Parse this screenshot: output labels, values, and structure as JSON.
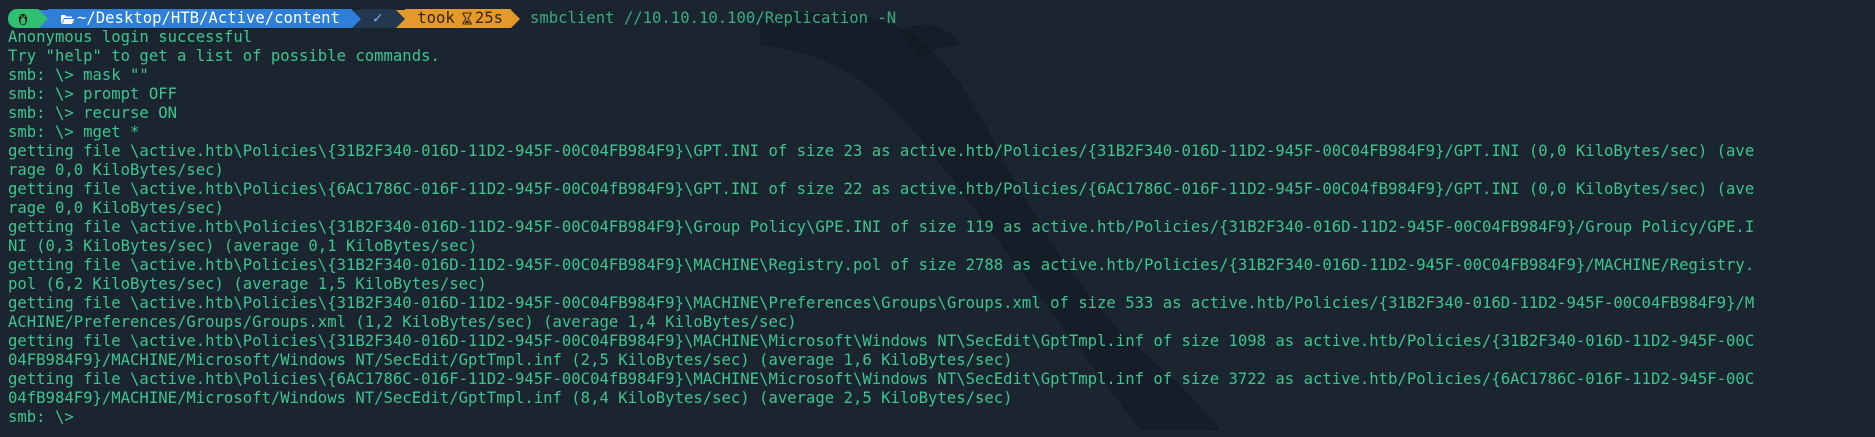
{
  "prompt": {
    "cwd": "~/Desktop/HTB/Active/content",
    "status": "✓",
    "took_label": "took",
    "took_time": "25s",
    "command": "smbclient //10.10.10.100/Replication -N"
  },
  "output": [
    "Anonymous login successful",
    "Try \"help\" to get a list of possible commands.",
    "smb: \\> mask \"\"",
    "smb: \\> prompt OFF",
    "smb: \\> recurse ON",
    "smb: \\> mget *",
    "getting file \\active.htb\\Policies\\{31B2F340-016D-11D2-945F-00C04FB984F9}\\GPT.INI of size 23 as active.htb/Policies/{31B2F340-016D-11D2-945F-00C04FB984F9}/GPT.INI (0,0 KiloBytes/sec) (ave",
    "rage 0,0 KiloBytes/sec)",
    "getting file \\active.htb\\Policies\\{6AC1786C-016F-11D2-945F-00C04fB984F9}\\GPT.INI of size 22 as active.htb/Policies/{6AC1786C-016F-11D2-945F-00C04fB984F9}/GPT.INI (0,0 KiloBytes/sec) (ave",
    "rage 0,0 KiloBytes/sec)",
    "getting file \\active.htb\\Policies\\{31B2F340-016D-11D2-945F-00C04FB984F9}\\Group Policy\\GPE.INI of size 119 as active.htb/Policies/{31B2F340-016D-11D2-945F-00C04FB984F9}/Group Policy/GPE.I",
    "NI (0,3 KiloBytes/sec) (average 0,1 KiloBytes/sec)",
    "getting file \\active.htb\\Policies\\{31B2F340-016D-11D2-945F-00C04FB984F9}\\MACHINE\\Registry.pol of size 2788 as active.htb/Policies/{31B2F340-016D-11D2-945F-00C04FB984F9}/MACHINE/Registry.",
    "pol (6,2 KiloBytes/sec) (average 1,5 KiloBytes/sec)",
    "getting file \\active.htb\\Policies\\{31B2F340-016D-11D2-945F-00C04FB984F9}\\MACHINE\\Preferences\\Groups\\Groups.xml of size 533 as active.htb/Policies/{31B2F340-016D-11D2-945F-00C04FB984F9}/M",
    "ACHINE/Preferences/Groups/Groups.xml (1,2 KiloBytes/sec) (average 1,4 KiloBytes/sec)",
    "getting file \\active.htb\\Policies\\{31B2F340-016D-11D2-945F-00C04FB984F9}\\MACHINE\\Microsoft\\Windows NT\\SecEdit\\GptTmpl.inf of size 1098 as active.htb/Policies/{31B2F340-016D-11D2-945F-00C",
    "04FB984F9}/MACHINE/Microsoft/Windows NT/SecEdit/GptTmpl.inf (2,5 KiloBytes/sec) (average 1,6 KiloBytes/sec)",
    "getting file \\active.htb\\Policies\\{6AC1786C-016F-11D2-945F-00C04fB984F9}\\MACHINE\\Microsoft\\Windows NT\\SecEdit\\GptTmpl.inf of size 3722 as active.htb/Policies/{6AC1786C-016F-11D2-945F-00C",
    "04fB984F9}/MACHINE/Microsoft/Windows NT/SecEdit/GptTmpl.inf (8,4 KiloBytes/sec) (average 2,5 KiloBytes/sec)",
    "smb: \\> "
  ],
  "colors": {
    "background": "#1b2530",
    "text": "#3ec48f",
    "os_segment": "#2fbf71",
    "dir_segment": "#2d7fd9",
    "status_segment": "#23384f",
    "time_segment": "#e39a2a"
  },
  "icons": {
    "os": "linux-penguin-icon",
    "dir": "folder-open-icon",
    "time": "hourglass-icon"
  }
}
